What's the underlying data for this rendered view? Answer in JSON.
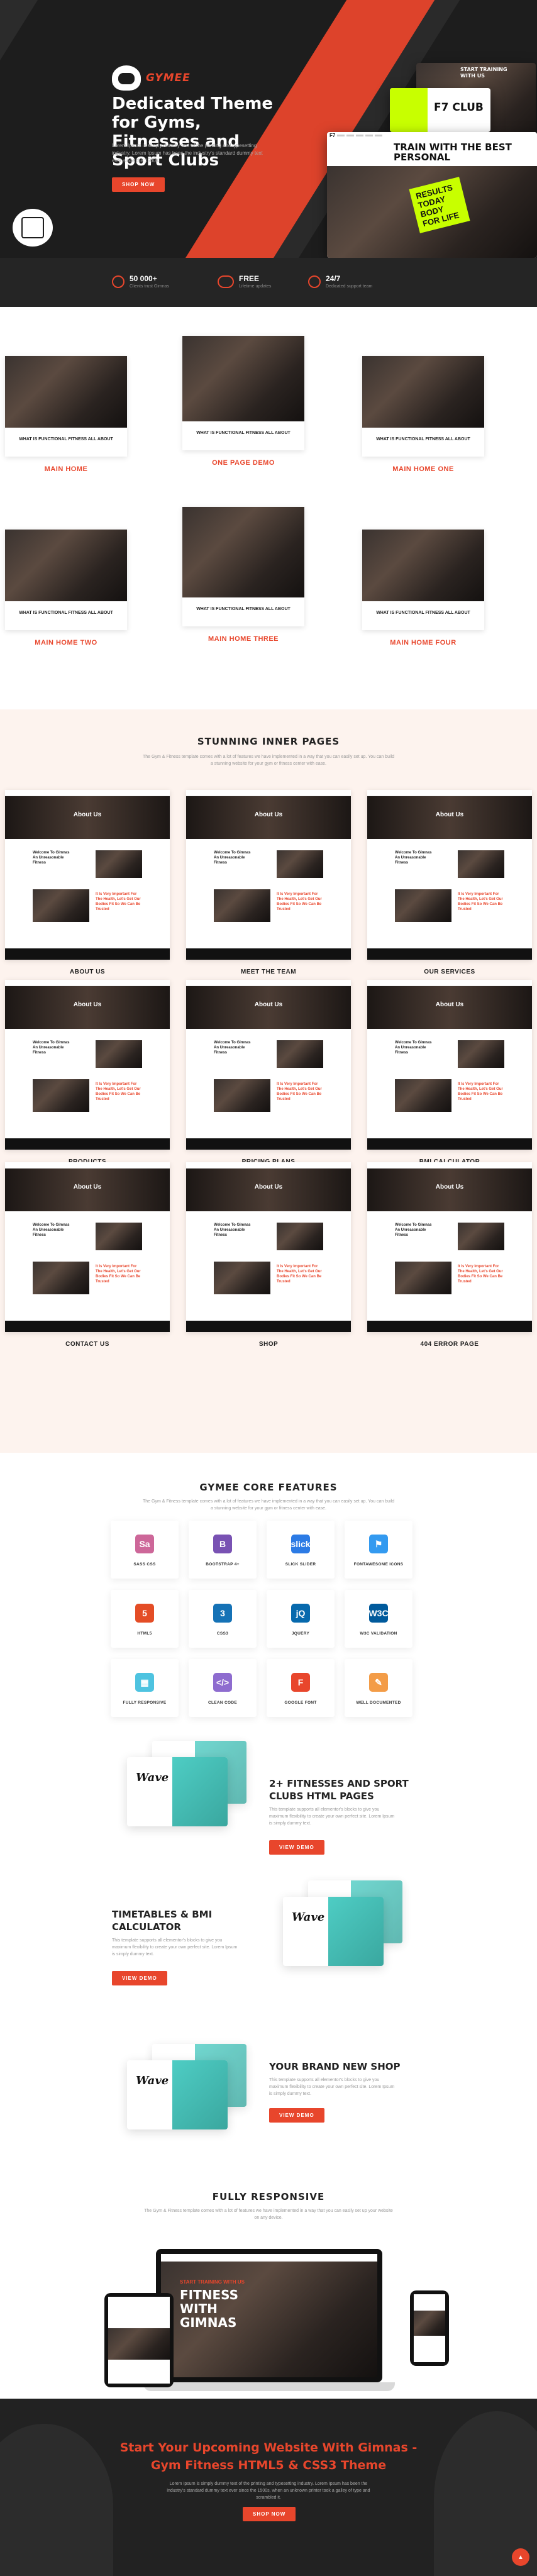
{
  "hero": {
    "logo_text": "GYMEE",
    "title": "Dedicated Theme for Gyms, Fitnesses and Sport Clubs",
    "description": "Lorem Ipsum is simply dummy text of the printing and typesetting industry. Lorem Ipsum has been the industry's standard dummy text ever since the 1500s.",
    "button": "Shop Now",
    "mock1_title": "START TRAINING WITH US",
    "mock2_title": "F7 CLUB",
    "mock3_title": "TRAIN WITH THE BEST PERSONAL",
    "lime_text": "RESULTS TODAY BODY FOR LIFE",
    "brand_badge": "F7"
  },
  "stats": [
    {
      "value": "50 000+",
      "label": "Clients trust Gimnas",
      "icon": "user-icon"
    },
    {
      "value": "FREE",
      "label": "Lifetime updates",
      "icon": "infinity-icon"
    },
    {
      "value": "24/7",
      "label": "Dedicated support team",
      "icon": "support-icon"
    }
  ],
  "demos": [
    {
      "caption": "WHAT IS FUNCTIONAL FITNESS ALL ABOUT",
      "label": "MAIN HOME"
    },
    {
      "caption": "WHAT IS FUNCTIONAL FITNESS ALL ABOUT",
      "label": "ONE PAGE DEMO"
    },
    {
      "caption": "WHAT IS FUNCTIONAL FITNESS ALL ABOUT",
      "label": "MAIN HOME ONE"
    },
    {
      "caption": "WHAT IS FUNCTIONAL FITNESS ALL ABOUT",
      "label": "MAIN HOME TWO"
    },
    {
      "caption": "WHAT IS FUNCTIONAL FITNESS ALL ABOUT",
      "label": "MAIN HOME THREE"
    },
    {
      "caption": "WHAT IS FUNCTIONAL FITNESS ALL ABOUT",
      "label": "MAIN HOME FOUR"
    }
  ],
  "inner": {
    "title": "STUNNING INNER PAGES",
    "description": "The Gym & Fitness template comes with a lot of features we have implemented in a way that you can easily set up. You can build a stunning website for your gym or fitness center with ease.",
    "page_hero": "About Us",
    "welcome": "Welcome To Gimnas An Unreasonable Fitness",
    "excellence": "It Is Very Important For The Health, Let's Get Our Bodies Fit So We Can Be Trusted",
    "pages": [
      "ABOUT US",
      "MEET THE TEAM",
      "OUR SERVICES",
      "PRODUCTS",
      "PRICING PLANS",
      "BMI CALCULATOR",
      "CONTACT US",
      "SHOP",
      "404 ERROR PAGE"
    ]
  },
  "features": {
    "title": "GYMEE CORE FEATURES",
    "description": "The Gym & Fitness template comes with a lot of features we have implemented in a way that you can easily set up. You can build a stunning website for your gym or fitness center with ease.",
    "items": [
      {
        "label": "SASS CSS",
        "glyph": "Sa",
        "color": "#cd6799",
        "icon": "sass-icon"
      },
      {
        "label": "BOOTSTRAP 4+",
        "glyph": "B",
        "color": "#7952b3",
        "icon": "bootstrap-icon"
      },
      {
        "label": "SLICK SLIDER",
        "glyph": "slick",
        "color": "#2c7be5",
        "icon": "slick-icon"
      },
      {
        "label": "FONTAWESOME ICONS",
        "glyph": "⚑",
        "color": "#339af0",
        "icon": "fontawesome-icon"
      },
      {
        "label": "HTML5",
        "glyph": "5",
        "color": "#e44d26",
        "icon": "html5-icon"
      },
      {
        "label": "CSS3",
        "glyph": "3",
        "color": "#1572b6",
        "icon": "css3-icon"
      },
      {
        "label": "JQUERY",
        "glyph": "jQ",
        "color": "#0769ad",
        "icon": "jquery-icon"
      },
      {
        "label": "W3C VALIDATION",
        "glyph": "W3C",
        "color": "#005a9c",
        "icon": "w3c-icon"
      },
      {
        "label": "FULLY RESPONSIVE",
        "glyph": "▦",
        "color": "#4ec3e0",
        "icon": "responsive-icon"
      },
      {
        "label": "CLEAN CODE",
        "glyph": "</>",
        "color": "#8e6ccf",
        "icon": "code-icon"
      },
      {
        "label": "GOOGLE FONT",
        "glyph": "F",
        "color": "#e8462c",
        "icon": "font-icon"
      },
      {
        "label": "WELL DOCUMENTED",
        "glyph": "✎",
        "color": "#f39c47",
        "icon": "document-icon"
      }
    ]
  },
  "blocks": [
    {
      "title": "2+ FITNESSES AND SPORT CLUBS HTML PAGES",
      "description": "This template supports all elementor's blocks to give you maximum flexibility to create your own perfect site. Lorem Ipsum is simply dummy text.",
      "button": "View Demo",
      "card_text": "Wave"
    },
    {
      "title": "TIMETABLES & BMI CALCULATOR",
      "description": "This template supports all elementor's blocks to give you maximum flexibility to create your own perfect site. Lorem Ipsum is simply dummy text.",
      "button": "View Demo",
      "card_text": "Wave"
    },
    {
      "title": "YOUR BRAND NEW SHOP",
      "description": "This template supports all elementor's blocks to give you maximum flexibility to create your own perfect site. Lorem Ipsum is simply dummy text.",
      "button": "View Demo",
      "card_text": "Wave"
    }
  ],
  "responsive": {
    "title": "FULLY RESPONSIVE",
    "description": "The Gym & Fitness template comes with a lot of features we have implemented in a way that you can easily set up your website on any device.",
    "screen_title": "FITNESS WITH GIMNAS",
    "screen_eyebrow": "START TRAINING WITH US"
  },
  "cta": {
    "title": "Start Your Upcoming Website With Gimnas - Gym Fitness HTML5 & CSS3 Theme",
    "description": "Lorem Ipsum is simply dummy text of the printing and typesetting industry. Lorem Ipsum has been the industry's standard dummy text ever since the 1500s, when an unknown printer took a galley of type and scrambled it.",
    "button": "Shop Now"
  },
  "fab_icon": "arrow-up-icon"
}
